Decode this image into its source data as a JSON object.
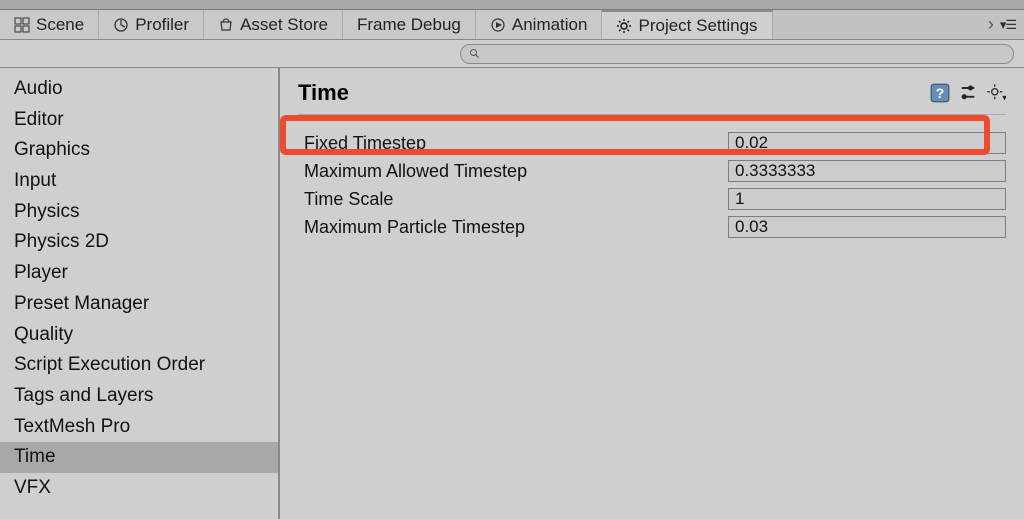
{
  "tabs": {
    "scene": "Scene",
    "profiler": "Profiler",
    "asset_store": "Asset Store",
    "frame_debug": "Frame Debug",
    "animation": "Animation",
    "project_settings": "Project Settings"
  },
  "search": {
    "placeholder": ""
  },
  "sidebar": {
    "items": [
      "Audio",
      "Editor",
      "Graphics",
      "Input",
      "Physics",
      "Physics 2D",
      "Player",
      "Preset Manager",
      "Quality",
      "Script Execution Order",
      "Tags and Layers",
      "TextMesh Pro",
      "Time",
      "VFX"
    ],
    "selected_index": 12
  },
  "panel": {
    "title": "Time",
    "properties": [
      {
        "label": "Fixed Timestep",
        "value": "0.02",
        "highlighted": true
      },
      {
        "label": "Maximum Allowed Timestep",
        "value": "0.3333333"
      },
      {
        "label": "Time Scale",
        "value": "1"
      },
      {
        "label": "Maximum Particle Timestep",
        "value": "0.03"
      }
    ]
  }
}
